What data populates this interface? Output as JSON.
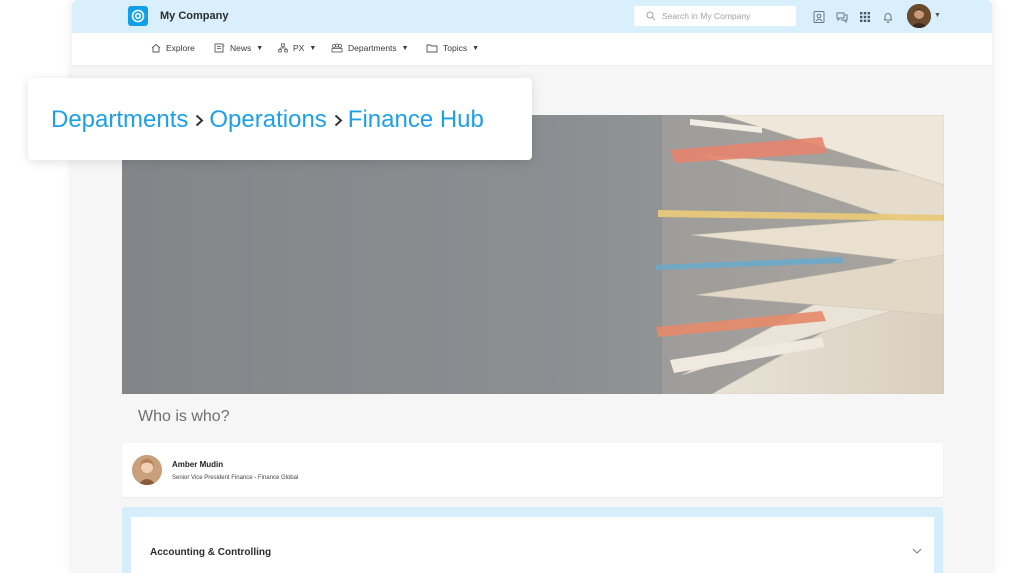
{
  "header": {
    "company_name": "My Company",
    "search_placeholder": "Search in My Company"
  },
  "nav": {
    "items": [
      {
        "label": "Explore",
        "icon": "home-icon",
        "dropdown": false
      },
      {
        "label": "News",
        "icon": "news-icon",
        "dropdown": true
      },
      {
        "label": "PX",
        "icon": "org-chart-icon",
        "dropdown": true
      },
      {
        "label": "Departments",
        "icon": "departments-icon",
        "dropdown": true
      },
      {
        "label": "Topics",
        "icon": "folder-icon",
        "dropdown": true
      }
    ],
    "dropdown_glyph": "▼"
  },
  "breadcrumb": {
    "items": [
      "Departments",
      "Operations",
      "Finance Hub"
    ],
    "separator": "›"
  },
  "page": {
    "section_title": "Who is who?"
  },
  "people": [
    {
      "name": "Amber Mudin",
      "role": "Senior Vice President Finance - Finance Global"
    }
  ],
  "accordion": {
    "title": "Accounting & Controlling"
  },
  "colors": {
    "accent": "#1ea0e6",
    "topbar": "#d9effc",
    "logo": "#0fa0e8"
  }
}
